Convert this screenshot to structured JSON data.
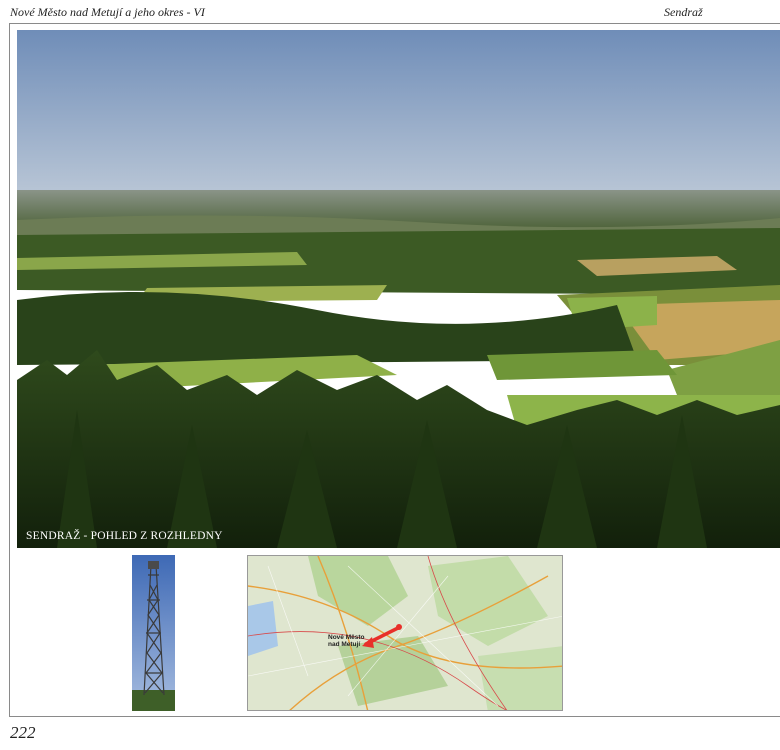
{
  "header": {
    "book_title": "Nové Město nad Metují a jeho okres - VI",
    "section_title": "Sendraž"
  },
  "photo": {
    "caption": "SENDRAŽ - POHLED Z ROZHLEDNY"
  },
  "map": {
    "place_label": "Nové Město nad Metují",
    "arrow_color": "#e8302a"
  },
  "page_number": "222"
}
